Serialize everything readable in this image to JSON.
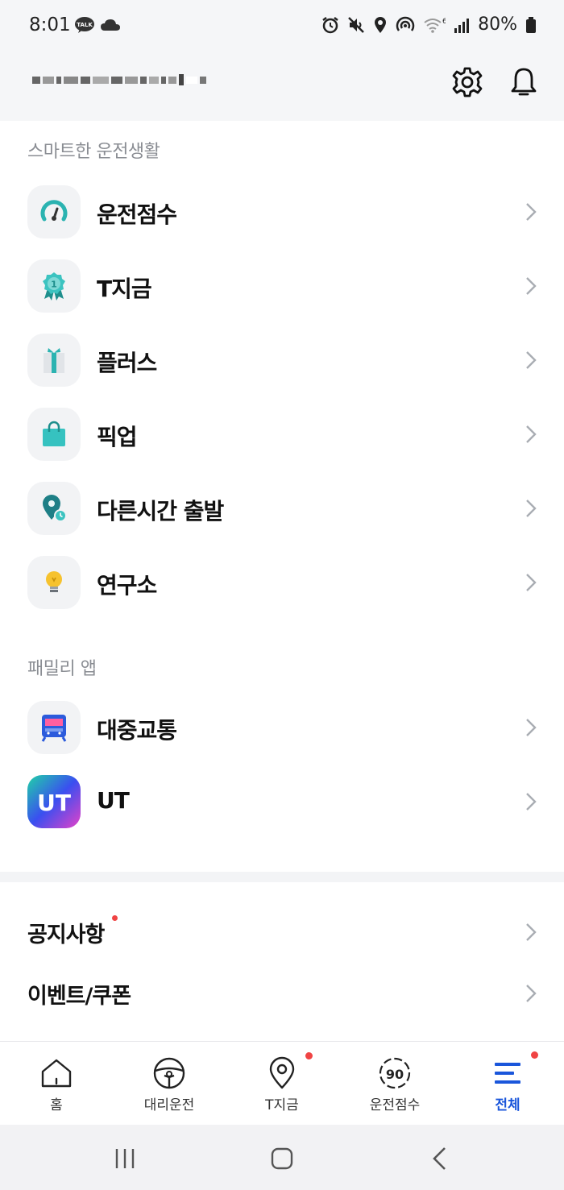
{
  "status_bar": {
    "time": "8:01",
    "left_icons": [
      "kakaotalk-icon",
      "cloud-icon"
    ],
    "right_icons": [
      "alarm-icon",
      "mute-icon",
      "location-icon",
      "hotspot-icon",
      "wifi-6-icon",
      "signal-icon"
    ],
    "battery": "80%"
  },
  "header": {
    "username_redacted": true,
    "icons": [
      "settings-icon",
      "bell-icon"
    ]
  },
  "section_smart": {
    "title": "스마트한 운전생활",
    "items": [
      {
        "label": "운전점수",
        "icon": "speedometer-icon"
      },
      {
        "label": "T지금",
        "icon": "medal-icon"
      },
      {
        "label": "플러스",
        "icon": "gift-icon"
      },
      {
        "label": "픽업",
        "icon": "shopping-bag-icon"
      },
      {
        "label": "다른시간 출발",
        "icon": "clock-pin-icon"
      },
      {
        "label": "연구소",
        "icon": "lightbulb-icon"
      }
    ]
  },
  "section_family": {
    "title": "패밀리 앱",
    "items": [
      {
        "label": "대중교통",
        "icon": "transit-icon"
      },
      {
        "label": "UT",
        "icon": "ut-app-icon"
      }
    ]
  },
  "links": {
    "notice": "공지사항",
    "event": "이벤트/쿠폰"
  },
  "bottom_nav": {
    "items": [
      {
        "label": "홈",
        "icon": "home-icon"
      },
      {
        "label": "대리운전",
        "icon": "steering-wheel-icon"
      },
      {
        "label": "T지금",
        "icon": "map-pin-icon"
      },
      {
        "label": "운전점수",
        "icon": "score-icon",
        "value": "90"
      },
      {
        "label": "전체",
        "icon": "menu-icon",
        "active": true
      }
    ]
  },
  "colors": {
    "accent": "#1a56db",
    "teal": "#2bb3b1",
    "notification_dot": "#f04444"
  }
}
